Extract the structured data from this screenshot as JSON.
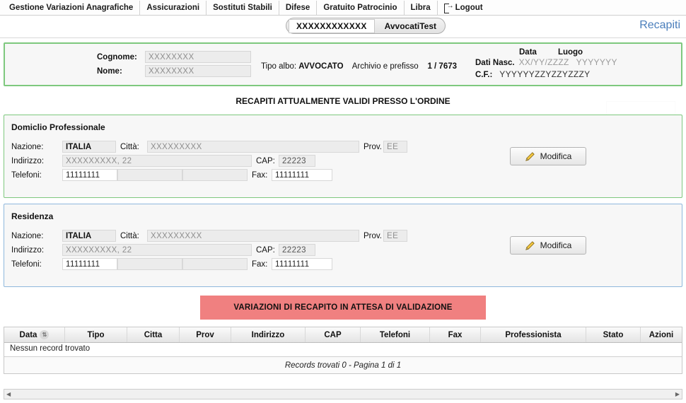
{
  "menu": {
    "items": [
      {
        "label": "Gestione Variazioni Anagrafiche"
      },
      {
        "label": "Assicurazioni"
      },
      {
        "label": "Sostituti Stabili"
      },
      {
        "label": "Difese"
      },
      {
        "label": "Gratuito Patrocinio"
      },
      {
        "label": "Libra"
      },
      {
        "label": "Logout",
        "icon": "logout-icon"
      }
    ]
  },
  "header": {
    "pill_code": "XXXXXXXXXXXX",
    "pill_name": "AvvocatiTest",
    "page_title": "Recapiti"
  },
  "identity": {
    "cognome_label": "Cognome:",
    "cognome_value": "XXXXXXXX",
    "nome_label": "Nome:",
    "nome_value": "XXXXXXXX",
    "tipo_albo_label": "Tipo albo:",
    "tipo_albo_value": "AVVOCATO",
    "archivio_label": "Archivio e prefisso",
    "archivio_value": "1 / 7673",
    "data_header": "Data",
    "luogo_header": "Luogo",
    "dati_nasc_label": "Dati Nasc.",
    "data_nascita_value": "XX/YY/ZZZZ",
    "luogo_nascita_value": "YYYYYYY",
    "cf_label": "C.F.:",
    "cf_value": "YYYYYYZZYZZYZZZY"
  },
  "section": {
    "caption": "RECAPITI ATTUALMENTE VALIDI PRESSO L'ORDINE"
  },
  "cards": [
    {
      "title": "Domiclio Professionale",
      "accent": "#7ec87e",
      "nazione_label": "Nazione:",
      "nazione_value": "ITALIA",
      "citta_label": "Città:",
      "citta_value": "XXXXXXXXX",
      "prov_label": "Prov.",
      "prov_value": "EE",
      "indirizzo_label": "Indirizzo:",
      "indirizzo_value": "XXXXXXXXX, 22",
      "cap_label": "CAP:",
      "cap_value": "22223",
      "telefoni_label": "Telefoni:",
      "telefono1": "11111111",
      "telefono2": "",
      "telefono3": "",
      "fax_label": "Fax:",
      "fax_value": "11111111",
      "button_label": "Modifica"
    },
    {
      "title": "Residenza",
      "accent": "#8fb8dd",
      "nazione_label": "Nazione:",
      "nazione_value": "ITALIA",
      "citta_label": "Città:",
      "citta_value": "XXXXXXXXX",
      "prov_label": "Prov.",
      "prov_value": "EE",
      "indirizzo_label": "Indirizzo:",
      "indirizzo_value": "XXXXXXXXX, 22",
      "cap_label": "CAP:",
      "cap_value": "22223",
      "telefoni_label": "Telefoni:",
      "telefono1": "11111111",
      "telefono2": "",
      "telefono3": "",
      "fax_label": "Fax:",
      "fax_value": "11111111",
      "button_label": "Modifica"
    }
  ],
  "pending_banner": {
    "label": "VARIAZIONI DI RECAPITO IN ATTESA DI VALIDAZIONE",
    "color": "#f08080"
  },
  "grid": {
    "columns": [
      {
        "label": "Data",
        "width": 86,
        "sorted": true
      },
      {
        "label": "Tipo",
        "width": 88
      },
      {
        "label": "Citta",
        "width": 74
      },
      {
        "label": "Prov",
        "width": 73
      },
      {
        "label": "Indirizzo",
        "width": 105
      },
      {
        "label": "CAP",
        "width": 78
      },
      {
        "label": "Telefoni",
        "width": 98
      },
      {
        "label": "Fax",
        "width": 72
      },
      {
        "label": "Professionista",
        "width": 149
      },
      {
        "label": "Stato",
        "width": 77
      },
      {
        "label": "Azioni",
        "width": 58
      }
    ],
    "empty_message": "Nessun record trovato",
    "footer": "Records trovati 0 - Pagina 1 di 1"
  },
  "scrollbar": {
    "left_arrow": "◀",
    "right_arrow": "▶"
  }
}
